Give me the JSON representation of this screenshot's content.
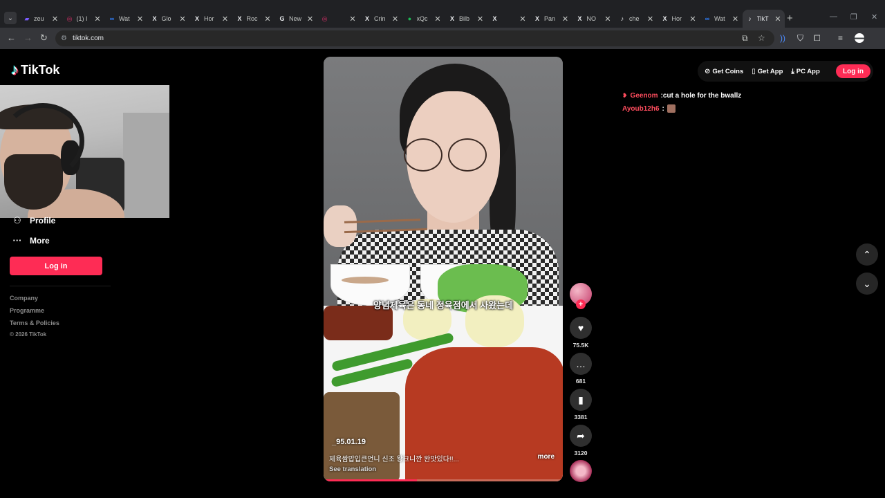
{
  "browser": {
    "tabs": [
      {
        "title": "zeu",
        "fav": "▰",
        "fav_color": "#7b5cff"
      },
      {
        "title": "(1) I",
        "fav": "◎",
        "fav_color": "#e1306c"
      },
      {
        "title": "Wat",
        "fav": "∞",
        "fav_color": "#2f7df6"
      },
      {
        "title": "Glo",
        "fav": "X",
        "fav_color": "#e8eaed"
      },
      {
        "title": "Hor",
        "fav": "X",
        "fav_color": "#e8eaed"
      },
      {
        "title": "Roc",
        "fav": "X",
        "fav_color": "#e8eaed"
      },
      {
        "title": "New",
        "fav": "G",
        "fav_color": "#e8eaed"
      },
      {
        "title": "",
        "fav": "◎",
        "fav_color": "#e1306c"
      },
      {
        "title": "Crin",
        "fav": "X",
        "fav_color": "#e8eaed"
      },
      {
        "title": "xQc",
        "fav": "●",
        "fav_color": "#1db954"
      },
      {
        "title": "Bilb",
        "fav": "X",
        "fav_color": "#e8eaed"
      },
      {
        "title": "",
        "fav": "X",
        "fav_color": "#e8eaed"
      },
      {
        "title": "Pan",
        "fav": "X",
        "fav_color": "#e8eaed"
      },
      {
        "title": "NO",
        "fav": "X",
        "fav_color": "#e8eaed"
      },
      {
        "title": "che",
        "fav": "♪",
        "fav_color": "#e8eaed"
      },
      {
        "title": "Hor",
        "fav": "X",
        "fav_color": "#e8eaed"
      },
      {
        "title": "Wat",
        "fav": "∞",
        "fav_color": "#2f7df6"
      },
      {
        "title": "TikT",
        "fav": "♪",
        "fav_color": "#e8eaed",
        "active": true
      }
    ],
    "url": "tiktok.com"
  },
  "tiktok": {
    "logo_text": "TikTok",
    "nav": {
      "profile": "Profile",
      "more": "More"
    },
    "sidebar_login": "Log in",
    "footer": {
      "company": "Company",
      "programme": "Programme",
      "terms": "Terms & Policies",
      "copyright": "© 2026 TikTok"
    },
    "topbar": {
      "get_coins": "Get Coins",
      "get_app": "Get App",
      "pc_app": "PC App",
      "login": "Log in"
    },
    "video": {
      "subtitle": "양념제육은 동네 정육점에서 사왔는데",
      "author": "_95.01.19",
      "description": "제육쌈밥입큰언니 신조 왕크니깐 완맛있다!!...",
      "more": "more",
      "see_translation": "See translation",
      "progress_fraction": 0.39
    },
    "actions": {
      "likes": "75.5K",
      "comments": "681",
      "saves": "3381",
      "shares": "3120"
    },
    "chat": [
      {
        "user": "Geenom",
        "message": "cut a hole for the bwallz"
      },
      {
        "user": "Ayoub12h6",
        "message": ""
      }
    ]
  },
  "colors": {
    "accent": "#fe2c55",
    "chat_user": "#ff4d5e"
  }
}
